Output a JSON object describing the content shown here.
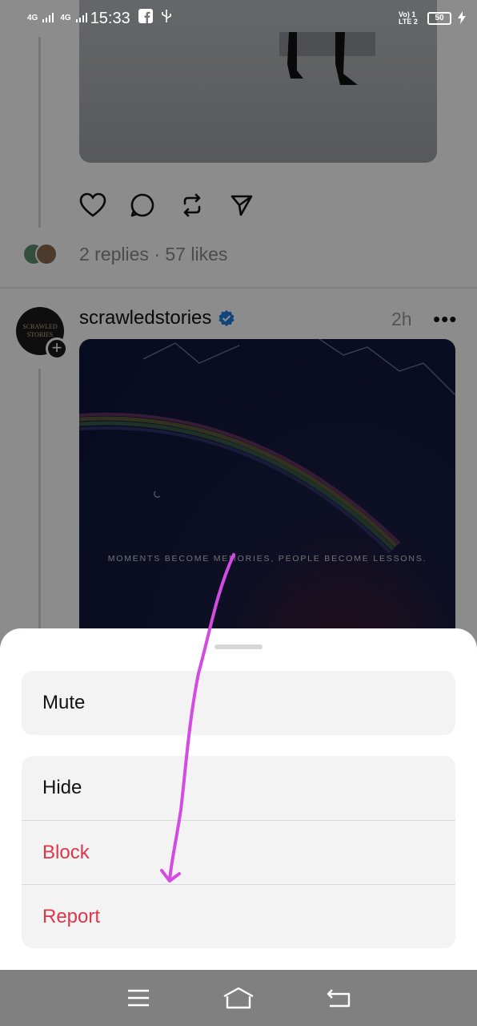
{
  "status_bar": {
    "signal_1": "4G",
    "signal_2": "4G",
    "time": "15:33",
    "volte": "Vo) 1 LTE 2",
    "battery": "50"
  },
  "post_1": {
    "replies_likes": "2 replies · 57 likes"
  },
  "post_2": {
    "avatar_text": "SCRAWLED STORIES",
    "username": "scrawledstories",
    "time_ago": "2h",
    "more": "•••",
    "image_caption": "MOMENTS BECOME MEMORIES, PEOPLE BECOME LESSONS."
  },
  "sheet": {
    "mute": "Mute",
    "hide": "Hide",
    "block": "Block",
    "report": "Report"
  },
  "colors": {
    "danger": "#e0344a",
    "annotation": "#d34be0",
    "verified": "#1d7fe0"
  }
}
